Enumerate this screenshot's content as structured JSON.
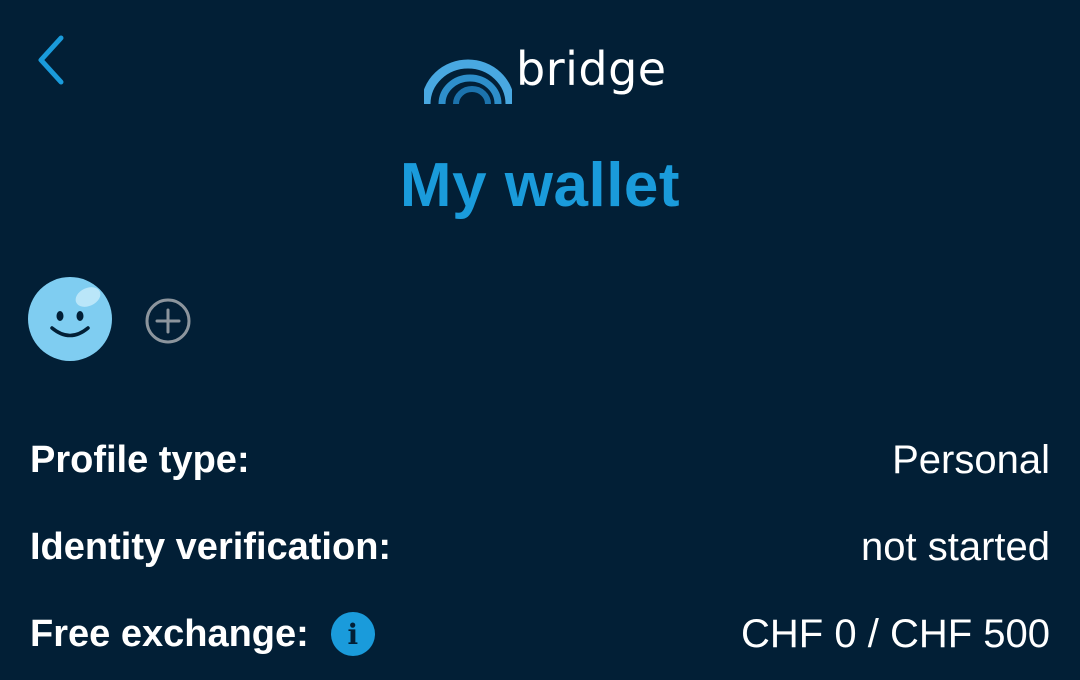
{
  "colors": {
    "background": "#021F36",
    "accent": "#1A9BDB",
    "avatar": "#7FCDF1",
    "text": "#FFFFFF",
    "muted_icon": "#8C959D"
  },
  "header": {
    "back_icon": "chevron-left-icon",
    "logo_icon": "bridge-arch-icon",
    "logo_text": "bridge"
  },
  "page": {
    "title": "My wallet"
  },
  "profiles": {
    "avatar_icon": "smiley-face-icon",
    "add_icon": "plus-circle-icon"
  },
  "details": {
    "profile_type": {
      "label": "Profile type:",
      "value": "Personal"
    },
    "identity_verification": {
      "label": "Identity verification:",
      "value": "not started"
    },
    "free_exchange": {
      "label": "Free exchange:",
      "info_icon": "info-icon",
      "value": "CHF 0 / CHF 500"
    }
  }
}
